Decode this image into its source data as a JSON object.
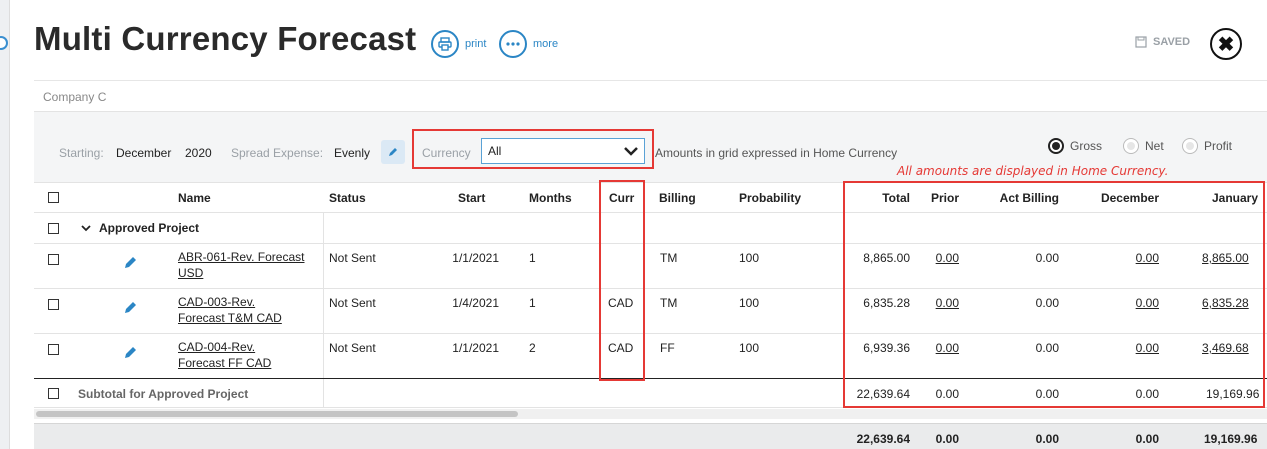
{
  "header": {
    "title": "Multi Currency Forecast",
    "print_label": "print",
    "more_label": "more",
    "saved_label": "SAVED"
  },
  "company": "Company C",
  "filters": {
    "starting_label": "Starting:",
    "starting_month": "December",
    "starting_year": "2020",
    "spread_label": "Spread Expense:",
    "spread_value": "Evenly",
    "currency_label": "Currency",
    "currency_value": "All",
    "amounts_note": "Amounts in grid expressed in Home Currency",
    "radios": [
      {
        "label": "Gross",
        "selected": true
      },
      {
        "label": "Net",
        "selected": false
      },
      {
        "label": "Profit",
        "selected": false
      }
    ]
  },
  "annotation": "All amounts are displayed in Home Currency.",
  "columns": [
    "Name",
    "Status",
    "Start",
    "Months",
    "Curr",
    "Billing",
    "Probability",
    "Total",
    "Prior",
    "Act Billing",
    "December",
    "January"
  ],
  "group": {
    "label": "Approved Project"
  },
  "rows": [
    {
      "name_line1": "ABR-061-Rev. Forecast",
      "name_line2": "USD",
      "status": "Not Sent",
      "start": "1/1/2021",
      "months": "1",
      "curr": "",
      "billing": "TM",
      "probability": "100",
      "total": "8,865.00",
      "prior": "0.00",
      "act_billing": "0.00",
      "december": "0.00",
      "january": "8,865.00"
    },
    {
      "name_line1": "CAD-003-Rev.",
      "name_line2": "Forecast T&M CAD",
      "status": "Not Sent",
      "start": "1/4/2021",
      "months": "1",
      "curr": "CAD",
      "billing": "TM",
      "probability": "100",
      "total": "6,835.28",
      "prior": "0.00",
      "act_billing": "0.00",
      "december": "0.00",
      "january": "6,835.28"
    },
    {
      "name_line1": "CAD-004-Rev.",
      "name_line2": "Forecast FF CAD",
      "status": "Not Sent",
      "start": "1/1/2021",
      "months": "2",
      "curr": "CAD",
      "billing": "FF",
      "probability": "100",
      "total": "6,939.36",
      "prior": "0.00",
      "act_billing": "0.00",
      "december": "0.00",
      "january": "3,469.68"
    }
  ],
  "subtotal": {
    "label": "Subtotal for Approved Project",
    "total": "22,639.64",
    "prior": "0.00",
    "act_billing": "0.00",
    "december": "0.00",
    "january": "19,169.96"
  },
  "grand_total": {
    "total": "22,639.64",
    "prior": "0.00",
    "act_billing": "0.00",
    "december": "0.00",
    "january": "19,169.96"
  },
  "colors": {
    "accent": "#2b86c5",
    "annotation_red": "#e53935"
  }
}
